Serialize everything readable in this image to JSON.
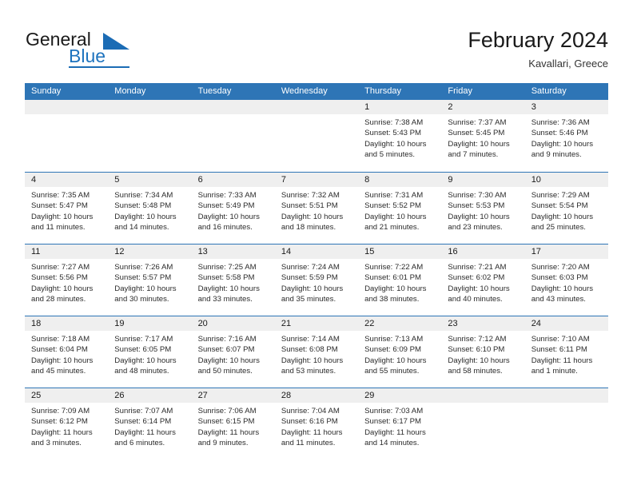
{
  "brand": {
    "name_part1": "General",
    "name_part2": "Blue",
    "logo_icon": "triangle-logo-icon"
  },
  "header": {
    "title": "February 2024",
    "subtitle": "Kavallari, Greece"
  },
  "calendar": {
    "weekday_headers": [
      "Sunday",
      "Monday",
      "Tuesday",
      "Wednesday",
      "Thursday",
      "Friday",
      "Saturday"
    ],
    "colors": {
      "header_blue": "#2e75b6",
      "band_gray": "#efefef",
      "brand_blue": "#1e73be",
      "text": "#1a1a1a"
    },
    "weeks": [
      [
        {
          "day": "",
          "sunrise": "",
          "sunset": "",
          "daylight1": "",
          "daylight2": "",
          "empty": true
        },
        {
          "day": "",
          "sunrise": "",
          "sunset": "",
          "daylight1": "",
          "daylight2": "",
          "empty": true
        },
        {
          "day": "",
          "sunrise": "",
          "sunset": "",
          "daylight1": "",
          "daylight2": "",
          "empty": true
        },
        {
          "day": "",
          "sunrise": "",
          "sunset": "",
          "daylight1": "",
          "daylight2": "",
          "empty": true
        },
        {
          "day": "1",
          "sunrise": "Sunrise: 7:38 AM",
          "sunset": "Sunset: 5:43 PM",
          "daylight1": "Daylight: 10 hours",
          "daylight2": "and 5 minutes.",
          "empty": false
        },
        {
          "day": "2",
          "sunrise": "Sunrise: 7:37 AM",
          "sunset": "Sunset: 5:45 PM",
          "daylight1": "Daylight: 10 hours",
          "daylight2": "and 7 minutes.",
          "empty": false
        },
        {
          "day": "3",
          "sunrise": "Sunrise: 7:36 AM",
          "sunset": "Sunset: 5:46 PM",
          "daylight1": "Daylight: 10 hours",
          "daylight2": "and 9 minutes.",
          "empty": false
        }
      ],
      [
        {
          "day": "4",
          "sunrise": "Sunrise: 7:35 AM",
          "sunset": "Sunset: 5:47 PM",
          "daylight1": "Daylight: 10 hours",
          "daylight2": "and 11 minutes.",
          "empty": false
        },
        {
          "day": "5",
          "sunrise": "Sunrise: 7:34 AM",
          "sunset": "Sunset: 5:48 PM",
          "daylight1": "Daylight: 10 hours",
          "daylight2": "and 14 minutes.",
          "empty": false
        },
        {
          "day": "6",
          "sunrise": "Sunrise: 7:33 AM",
          "sunset": "Sunset: 5:49 PM",
          "daylight1": "Daylight: 10 hours",
          "daylight2": "and 16 minutes.",
          "empty": false
        },
        {
          "day": "7",
          "sunrise": "Sunrise: 7:32 AM",
          "sunset": "Sunset: 5:51 PM",
          "daylight1": "Daylight: 10 hours",
          "daylight2": "and 18 minutes.",
          "empty": false
        },
        {
          "day": "8",
          "sunrise": "Sunrise: 7:31 AM",
          "sunset": "Sunset: 5:52 PM",
          "daylight1": "Daylight: 10 hours",
          "daylight2": "and 21 minutes.",
          "empty": false
        },
        {
          "day": "9",
          "sunrise": "Sunrise: 7:30 AM",
          "sunset": "Sunset: 5:53 PM",
          "daylight1": "Daylight: 10 hours",
          "daylight2": "and 23 minutes.",
          "empty": false
        },
        {
          "day": "10",
          "sunrise": "Sunrise: 7:29 AM",
          "sunset": "Sunset: 5:54 PM",
          "daylight1": "Daylight: 10 hours",
          "daylight2": "and 25 minutes.",
          "empty": false
        }
      ],
      [
        {
          "day": "11",
          "sunrise": "Sunrise: 7:27 AM",
          "sunset": "Sunset: 5:56 PM",
          "daylight1": "Daylight: 10 hours",
          "daylight2": "and 28 minutes.",
          "empty": false
        },
        {
          "day": "12",
          "sunrise": "Sunrise: 7:26 AM",
          "sunset": "Sunset: 5:57 PM",
          "daylight1": "Daylight: 10 hours",
          "daylight2": "and 30 minutes.",
          "empty": false
        },
        {
          "day": "13",
          "sunrise": "Sunrise: 7:25 AM",
          "sunset": "Sunset: 5:58 PM",
          "daylight1": "Daylight: 10 hours",
          "daylight2": "and 33 minutes.",
          "empty": false
        },
        {
          "day": "14",
          "sunrise": "Sunrise: 7:24 AM",
          "sunset": "Sunset: 5:59 PM",
          "daylight1": "Daylight: 10 hours",
          "daylight2": "and 35 minutes.",
          "empty": false
        },
        {
          "day": "15",
          "sunrise": "Sunrise: 7:22 AM",
          "sunset": "Sunset: 6:01 PM",
          "daylight1": "Daylight: 10 hours",
          "daylight2": "and 38 minutes.",
          "empty": false
        },
        {
          "day": "16",
          "sunrise": "Sunrise: 7:21 AM",
          "sunset": "Sunset: 6:02 PM",
          "daylight1": "Daylight: 10 hours",
          "daylight2": "and 40 minutes.",
          "empty": false
        },
        {
          "day": "17",
          "sunrise": "Sunrise: 7:20 AM",
          "sunset": "Sunset: 6:03 PM",
          "daylight1": "Daylight: 10 hours",
          "daylight2": "and 43 minutes.",
          "empty": false
        }
      ],
      [
        {
          "day": "18",
          "sunrise": "Sunrise: 7:18 AM",
          "sunset": "Sunset: 6:04 PM",
          "daylight1": "Daylight: 10 hours",
          "daylight2": "and 45 minutes.",
          "empty": false
        },
        {
          "day": "19",
          "sunrise": "Sunrise: 7:17 AM",
          "sunset": "Sunset: 6:05 PM",
          "daylight1": "Daylight: 10 hours",
          "daylight2": "and 48 minutes.",
          "empty": false
        },
        {
          "day": "20",
          "sunrise": "Sunrise: 7:16 AM",
          "sunset": "Sunset: 6:07 PM",
          "daylight1": "Daylight: 10 hours",
          "daylight2": "and 50 minutes.",
          "empty": false
        },
        {
          "day": "21",
          "sunrise": "Sunrise: 7:14 AM",
          "sunset": "Sunset: 6:08 PM",
          "daylight1": "Daylight: 10 hours",
          "daylight2": "and 53 minutes.",
          "empty": false
        },
        {
          "day": "22",
          "sunrise": "Sunrise: 7:13 AM",
          "sunset": "Sunset: 6:09 PM",
          "daylight1": "Daylight: 10 hours",
          "daylight2": "and 55 minutes.",
          "empty": false
        },
        {
          "day": "23",
          "sunrise": "Sunrise: 7:12 AM",
          "sunset": "Sunset: 6:10 PM",
          "daylight1": "Daylight: 10 hours",
          "daylight2": "and 58 minutes.",
          "empty": false
        },
        {
          "day": "24",
          "sunrise": "Sunrise: 7:10 AM",
          "sunset": "Sunset: 6:11 PM",
          "daylight1": "Daylight: 11 hours",
          "daylight2": "and 1 minute.",
          "empty": false
        }
      ],
      [
        {
          "day": "25",
          "sunrise": "Sunrise: 7:09 AM",
          "sunset": "Sunset: 6:12 PM",
          "daylight1": "Daylight: 11 hours",
          "daylight2": "and 3 minutes.",
          "empty": false
        },
        {
          "day": "26",
          "sunrise": "Sunrise: 7:07 AM",
          "sunset": "Sunset: 6:14 PM",
          "daylight1": "Daylight: 11 hours",
          "daylight2": "and 6 minutes.",
          "empty": false
        },
        {
          "day": "27",
          "sunrise": "Sunrise: 7:06 AM",
          "sunset": "Sunset: 6:15 PM",
          "daylight1": "Daylight: 11 hours",
          "daylight2": "and 9 minutes.",
          "empty": false
        },
        {
          "day": "28",
          "sunrise": "Sunrise: 7:04 AM",
          "sunset": "Sunset: 6:16 PM",
          "daylight1": "Daylight: 11 hours",
          "daylight2": "and 11 minutes.",
          "empty": false
        },
        {
          "day": "29",
          "sunrise": "Sunrise: 7:03 AM",
          "sunset": "Sunset: 6:17 PM",
          "daylight1": "Daylight: 11 hours",
          "daylight2": "and 14 minutes.",
          "empty": false
        },
        {
          "day": "",
          "sunrise": "",
          "sunset": "",
          "daylight1": "",
          "daylight2": "",
          "empty": true
        },
        {
          "day": "",
          "sunrise": "",
          "sunset": "",
          "daylight1": "",
          "daylight2": "",
          "empty": true
        }
      ]
    ]
  }
}
